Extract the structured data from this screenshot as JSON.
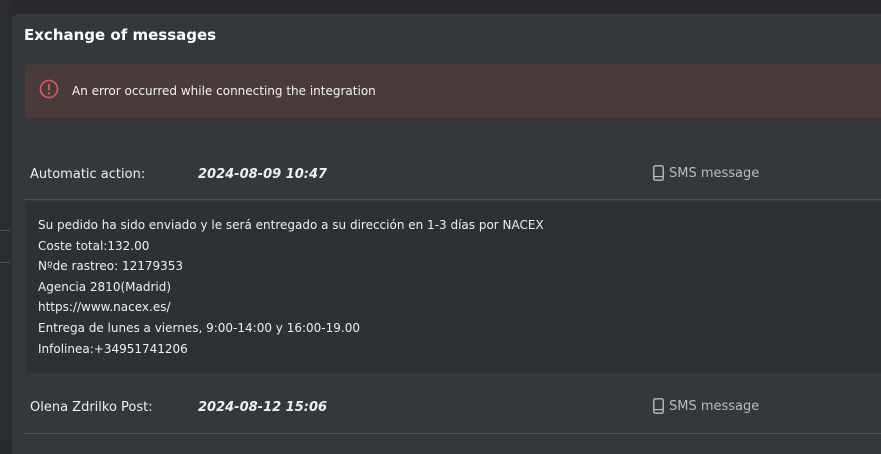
{
  "panel": {
    "title": "Exchange of messages"
  },
  "alert": {
    "text": "An error occurred while connecting the integration",
    "icon": "error-circle-icon",
    "color": "#e05a57"
  },
  "messages": [
    {
      "sender": "Automatic action:",
      "date": "2024-08-09 10:47",
      "channel": "SMS message",
      "channel_icon": "mobile-phone-icon",
      "body": [
        "Su pedido ha sido enviado y le será entregado a su dirección en 1-3 días por NACEX",
        "Coste total:132.00",
        "Nºde rastreo: 12179353",
        "Agencia 2810(Madrid)",
        "https://www.nacex.es/",
        "Entrega de lunes a viernes, 9:00-14:00 y 16:00-19.00",
        "Infolinea:+34951741206"
      ]
    },
    {
      "sender": "Olena Zdrilko Post:",
      "date": "2024-08-12 15:06",
      "channel": "SMS message",
      "channel_icon": "mobile-phone-icon"
    }
  ]
}
